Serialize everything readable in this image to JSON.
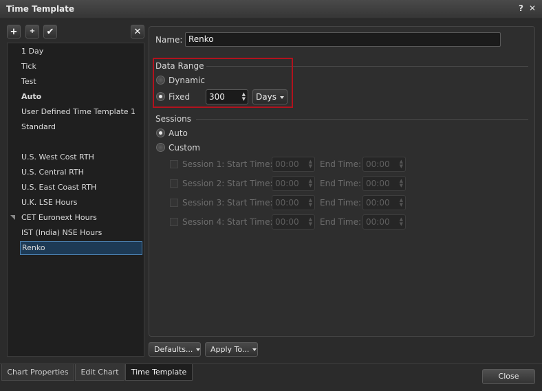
{
  "window": {
    "title": "Time Template",
    "help_label": "?",
    "close_label": "✕"
  },
  "toolbar": {
    "add": "+",
    "add_sub": "+",
    "apply": "✔",
    "remove": "✕"
  },
  "templates": [
    {
      "label": "1 Day"
    },
    {
      "label": "Tick"
    },
    {
      "label": "Test"
    },
    {
      "label": "Auto"
    },
    {
      "label": "User Defined Time Template 1"
    },
    {
      "label": "Standard"
    },
    {
      "label": "U.S. West Cost RTH"
    },
    {
      "label": "U.S. Central RTH"
    },
    {
      "label": "U.S. East Coast RTH"
    },
    {
      "label": "U.K. LSE Hours"
    },
    {
      "label": "CET Euronext Hours"
    },
    {
      "label": "IST (India) NSE Hours"
    },
    {
      "label": "Renko"
    }
  ],
  "selected_template": "Renko",
  "name": {
    "label": "Name:",
    "value": "Renko"
  },
  "data_range": {
    "title": "Data Range",
    "dynamic_label": "Dynamic",
    "fixed_label": "Fixed",
    "selected": "Fixed",
    "fixed_value": "300",
    "unit": "Days"
  },
  "sessions": {
    "title": "Sessions",
    "auto_label": "Auto",
    "custom_label": "Custom",
    "selected": "Auto",
    "rows": [
      {
        "label": "Session 1:",
        "start_label": "Start Time:",
        "start": "00:00",
        "end_label": "End Time:",
        "end": "00:00"
      },
      {
        "label": "Session 2:",
        "start_label": "Start Time:",
        "start": "00:00",
        "end_label": "End Time:",
        "end": "00:00"
      },
      {
        "label": "Session 3:",
        "start_label": "Start Time:",
        "start": "00:00",
        "end_label": "End Time:",
        "end": "00:00"
      },
      {
        "label": "Session 4:",
        "start_label": "Start Time:",
        "start": "00:00",
        "end_label": "End Time:",
        "end": "00:00"
      }
    ]
  },
  "buttons": {
    "defaults": "Defaults...",
    "apply_to": "Apply To...",
    "close": "Close"
  },
  "tabs": [
    {
      "label": "Chart Properties"
    },
    {
      "label": "Edit Chart"
    },
    {
      "label": "Time Template"
    }
  ],
  "colors": {
    "highlight": "#b2121d",
    "selection": "#1d3a55"
  }
}
